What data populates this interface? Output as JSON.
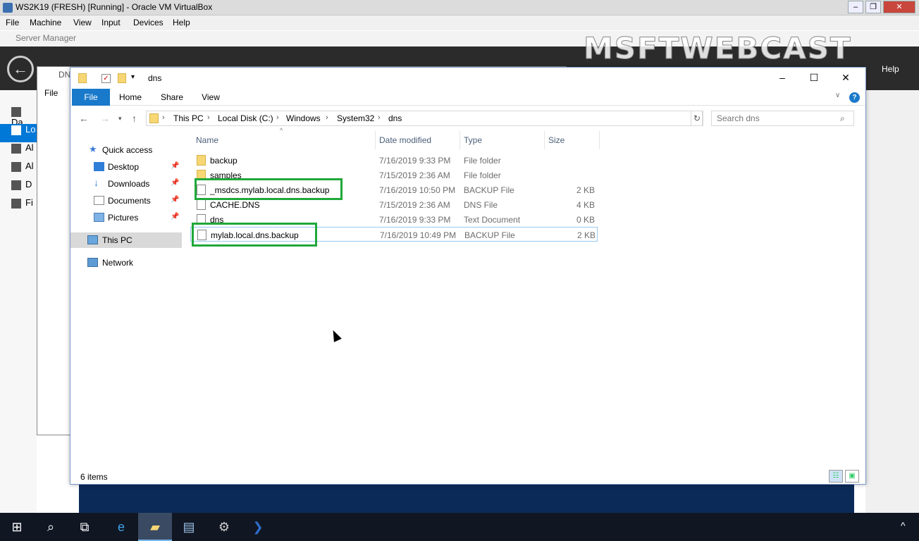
{
  "vbox": {
    "title": "WS2K19 (FRESH) [Running] - Oracle VM VirtualBox",
    "menu": [
      "File",
      "Machine",
      "View",
      "Input",
      "Devices",
      "Help"
    ]
  },
  "server_manager": {
    "title": "Server Manager",
    "help": "Help",
    "nav": [
      "Da",
      "Lo",
      "Al",
      "Al",
      "D",
      "Fi"
    ],
    "dns_window": {
      "title": "DN",
      "menu_file": "File"
    }
  },
  "watermark": "MSFTWEBCAST",
  "explorer": {
    "title": "dns",
    "ribbon_tabs": [
      "File",
      "Home",
      "Share",
      "View"
    ],
    "breadcrumb": [
      "This PC",
      "Local Disk (C:)",
      "Windows",
      "System32",
      "dns"
    ],
    "search_placeholder": "Search dns",
    "nav_pane": [
      {
        "label": "Quick access",
        "icon": "star-icon"
      },
      {
        "label": "Desktop",
        "icon": "desktop-icon",
        "pinned": true
      },
      {
        "label": "Downloads",
        "icon": "download-icon",
        "pinned": true
      },
      {
        "label": "Documents",
        "icon": "documents-icon",
        "pinned": true
      },
      {
        "label": "Pictures",
        "icon": "pictures-icon",
        "pinned": true
      },
      {
        "label": "This PC",
        "icon": "computer-icon",
        "selected": true
      },
      {
        "label": "Network",
        "icon": "network-icon"
      }
    ],
    "columns": {
      "name": "Name",
      "date": "Date modified",
      "type": "Type",
      "size": "Size"
    },
    "files": [
      {
        "name": "backup",
        "date": "7/16/2019 9:33 PM",
        "type": "File folder",
        "size": "",
        "kind": "folder"
      },
      {
        "name": "samples",
        "date": "7/15/2019 2:36 AM",
        "type": "File folder",
        "size": "",
        "kind": "folder"
      },
      {
        "name": "_msdcs.mylab.local.dns.backup",
        "date": "7/16/2019 10:50 PM",
        "type": "BACKUP File",
        "size": "2 KB",
        "kind": "doc",
        "highlighted": true
      },
      {
        "name": "CACHE.DNS",
        "date": "7/15/2019 2:36 AM",
        "type": "DNS File",
        "size": "4 KB",
        "kind": "doc"
      },
      {
        "name": "dns",
        "date": "7/16/2019 9:33 PM",
        "type": "Text Document",
        "size": "0 KB",
        "kind": "doc"
      },
      {
        "name": "mylab.local.dns.backup",
        "date": "7/16/2019 10:49 PM",
        "type": "BACKUP File",
        "size": "2 KB",
        "kind": "doc",
        "highlighted": true,
        "focused": true
      }
    ],
    "status": "6 items"
  },
  "colors": {
    "accent": "#1979ca",
    "highlight_box": "#20a83a",
    "taskbar": "#101622",
    "sm_header": "#2b2b2b"
  },
  "taskbar": [
    "start-icon",
    "search-icon",
    "task-view-icon",
    "internet-explorer-icon",
    "file-explorer-icon",
    "server-manager-icon",
    "dns-manager-icon",
    "powershell-icon"
  ]
}
